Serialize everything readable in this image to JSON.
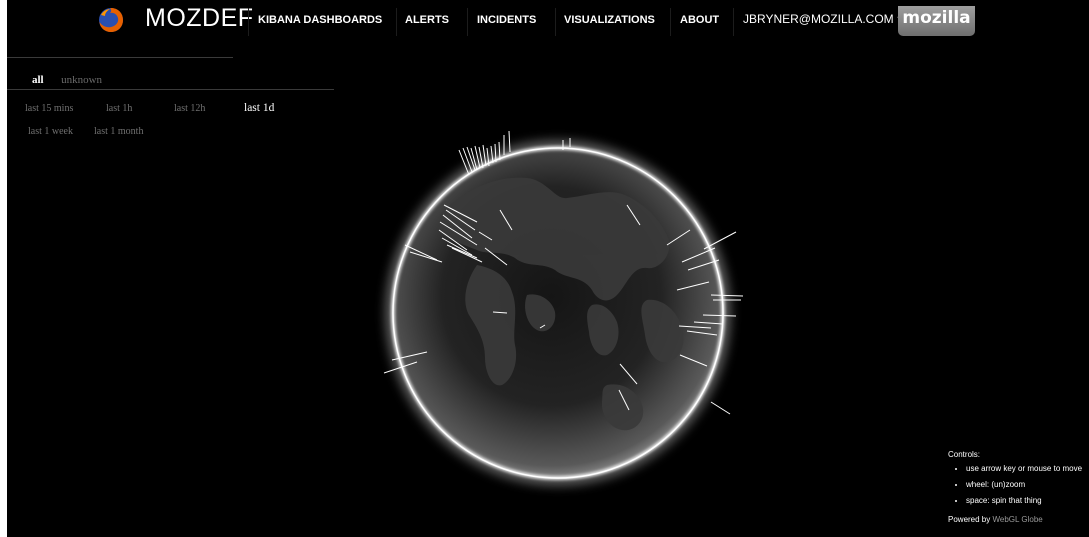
{
  "header": {
    "brand": "MOZDEF",
    "nav": [
      {
        "label": "KIBANA DASHBOARDS"
      },
      {
        "label": "ALERTS"
      },
      {
        "label": "INCIDENTS"
      },
      {
        "label": "VISUALIZATIONS"
      },
      {
        "label": "ABOUT"
      }
    ],
    "user": "JBRYNER@MOZILLA.COM",
    "org_tab": "mozilla"
  },
  "filters": {
    "categories": [
      {
        "label": "all",
        "active": true
      },
      {
        "label": "unknown",
        "active": false
      }
    ],
    "ranges": [
      {
        "label": "last 15 mins",
        "active": false
      },
      {
        "label": "last 1h",
        "active": false
      },
      {
        "label": "last 12h",
        "active": false
      },
      {
        "label": "last 1d",
        "active": true
      },
      {
        "label": "last 1 week",
        "active": false
      },
      {
        "label": "last 1 month",
        "active": false
      }
    ]
  },
  "controls": {
    "title": "Controls:",
    "items": [
      "use arrow key or mouse to move",
      "wheel: (un)zoom",
      "space: spin that thing"
    ],
    "powered_prefix": "Powered by",
    "powered_link": "WebGL Globe"
  },
  "icons": {
    "logo": "firefox-logo-icon",
    "user_caret": "caret-down-icon"
  },
  "colors": {
    "background": "#000000",
    "text": "#ffffff",
    "muted_text": "#707070",
    "org_tab": "#888888",
    "globe_glow": "#ffffff"
  }
}
